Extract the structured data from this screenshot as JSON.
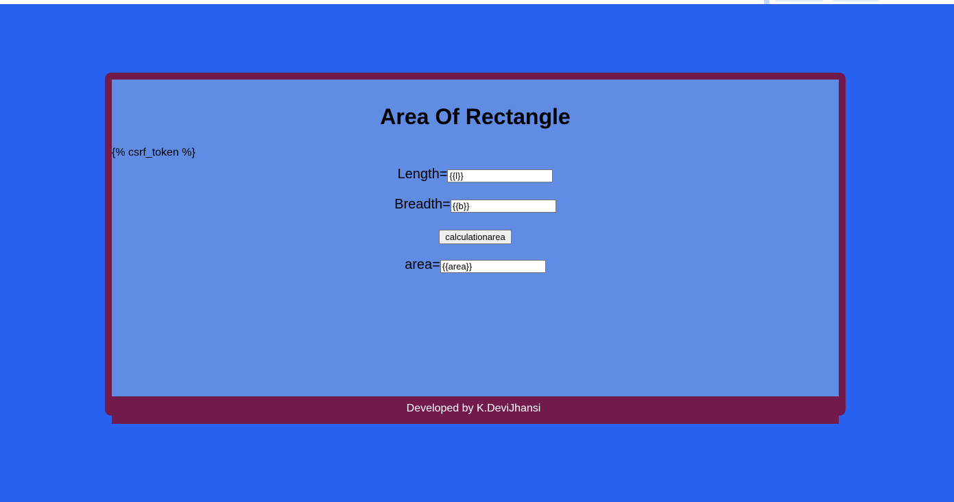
{
  "page": {
    "title": "Area Of Rectangle",
    "csrf_text": "{% csrf_token %}"
  },
  "form": {
    "length_label": "Length=",
    "length_value": "{{l}}",
    "breadth_label": "Breadth=",
    "breadth_value": "{{b}}",
    "submit_label": "calculationarea",
    "area_label": "area=",
    "area_value": "{{area}}"
  },
  "footer": {
    "text": "Developed by K.DeviJhansi"
  },
  "colors": {
    "background": "#2961f0",
    "frame": "#731a4d",
    "panel": "#608ce4"
  }
}
